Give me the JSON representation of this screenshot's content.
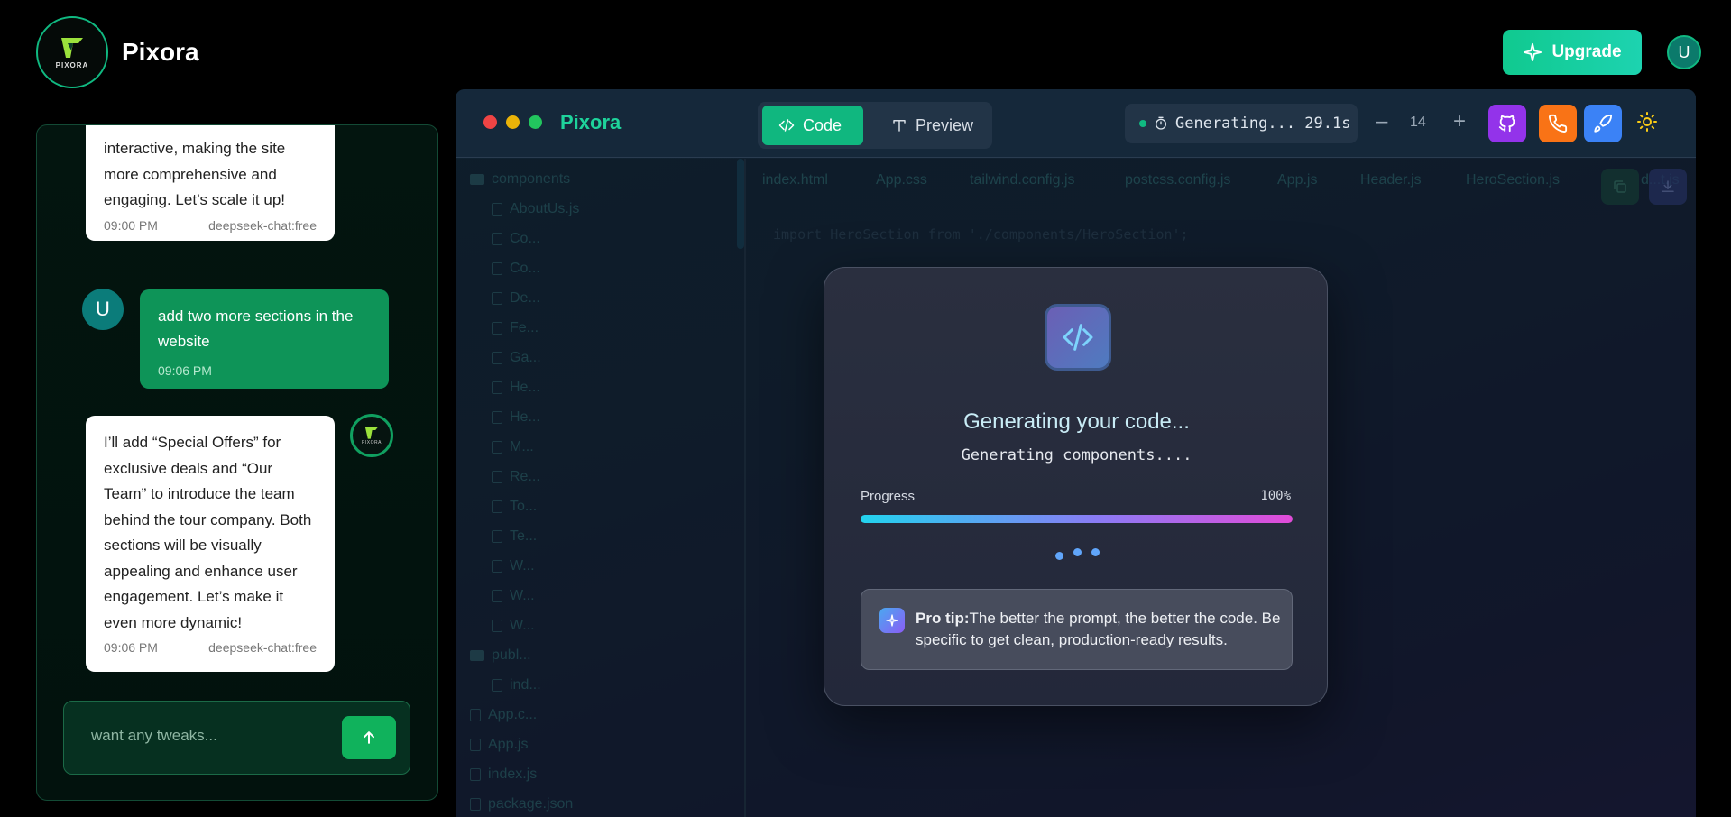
{
  "app": {
    "brand": "Pixora",
    "logo_small_text": "PIXORA",
    "upgrade_label": "Upgrade",
    "user_initial": "U"
  },
  "chat": {
    "messages": [
      {
        "role": "assistant",
        "text": "interactive, making the site more comprehensive and engaging. Let’s scale it up!",
        "time": "09:00 PM",
        "model": "deepseek-chat:free"
      },
      {
        "role": "user",
        "avatar": "U",
        "text": "add two more sections in the website",
        "time": "09:06 PM"
      },
      {
        "role": "assistant",
        "text": "I’ll add “Special Offers” for exclusive deals and “Our Team” to introduce the team behind the tour company. Both sections will be visually appealing and enhance user engagement. Let’s make it even more dynamic!",
        "time": "09:06 PM",
        "model": "deepseek-chat:free"
      }
    ],
    "input_placeholder": "want any tweaks..."
  },
  "editor": {
    "title": "Pixora",
    "tabs_mode": {
      "code": "Code",
      "preview": "Preview"
    },
    "status": "Generating... 29.1s",
    "zoom": "14",
    "file_tree": [
      {
        "name": "components",
        "type": "folder"
      },
      {
        "name": "AboutUs.js",
        "type": "file"
      },
      {
        "name": "Co...",
        "type": "file"
      },
      {
        "name": "Co...",
        "type": "file"
      },
      {
        "name": "De...",
        "type": "file"
      },
      {
        "name": "Fe...",
        "type": "file"
      },
      {
        "name": "Ga...",
        "type": "file"
      },
      {
        "name": "He...",
        "type": "file"
      },
      {
        "name": "He...",
        "type": "file"
      },
      {
        "name": "M...",
        "type": "file"
      },
      {
        "name": "Re...",
        "type": "file"
      },
      {
        "name": "To...",
        "type": "file"
      },
      {
        "name": "Te...",
        "type": "file"
      },
      {
        "name": "W...",
        "type": "file"
      },
      {
        "name": "W...",
        "type": "file"
      },
      {
        "name": "W...",
        "type": "file"
      },
      {
        "name": "publ...",
        "type": "folder"
      },
      {
        "name": "ind...",
        "type": "file"
      },
      {
        "name": "App.c...",
        "type": "file"
      },
      {
        "name": "App.js",
        "type": "file"
      },
      {
        "name": "index.js",
        "type": "file"
      },
      {
        "name": "package.json",
        "type": "file"
      }
    ],
    "file_tabs": [
      "index.html",
      "App.css",
      "tailwind.config.js",
      "postcss.config.js",
      "App.js",
      "Header.js",
      "HeroSection.js",
      "d...t.js"
    ],
    "code_line": "import HeroSection from './components/HeroSection';"
  },
  "modal": {
    "title": "Generating your code...",
    "subtitle": "Generating components....",
    "progress_label": "Progress",
    "progress_text": "100%",
    "progress": 1.0,
    "tip_bold": "Pro tip:",
    "tip_text": "The better the prompt, the better the code. Be specific to get clean, production-ready results."
  }
}
